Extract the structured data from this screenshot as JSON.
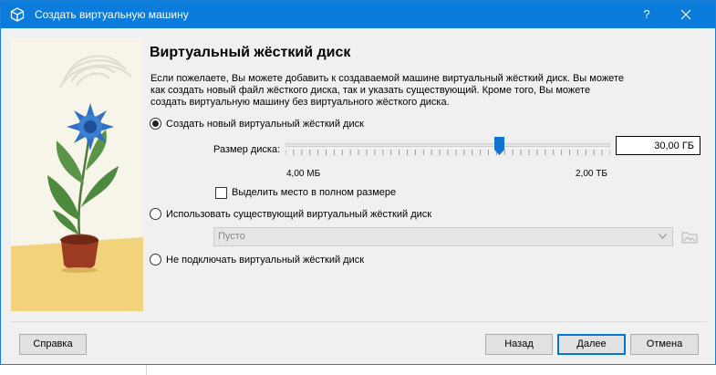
{
  "window": {
    "title": "Создать виртуальную машину",
    "help_label": "?"
  },
  "page": {
    "title": "Виртуальный жёсткий диск",
    "description_lines": [
      "Если пожелаете, Вы можете добавить к создаваемой машине виртуальный жёсткий диск. Вы можете",
      "как создать новый файл жёсткого диска, так и указать существующий. Кроме того, Вы можете",
      "создать виртуальную машину без виртуального жёсткого диска."
    ]
  },
  "options": {
    "create_new": {
      "label": "Создать новый виртуальный жёсткий диск",
      "selected": true
    },
    "use_existing": {
      "label": "Использовать существующий виртуальный жёсткий диск",
      "selected": false
    },
    "no_disk": {
      "label": "Не подключать виртуальный жёсткий диск",
      "selected": false
    }
  },
  "disk_size": {
    "label": "Размер диска:",
    "value": "30,00 ГБ",
    "min_label": "4,00 МБ",
    "max_label": "2,00 ТБ",
    "slider_fraction": 0.66
  },
  "preallocate": {
    "label": "Выделить место в полном размере",
    "checked": false
  },
  "existing_disk": {
    "selected": "Пусто"
  },
  "buttons": {
    "help": "Справка",
    "back": "Назад",
    "next": "Далее",
    "cancel": "Отмена"
  },
  "colors": {
    "titlebar": "#0b7bdc",
    "slider_thumb": "#1174d2",
    "flower": "#2f6fc4"
  }
}
